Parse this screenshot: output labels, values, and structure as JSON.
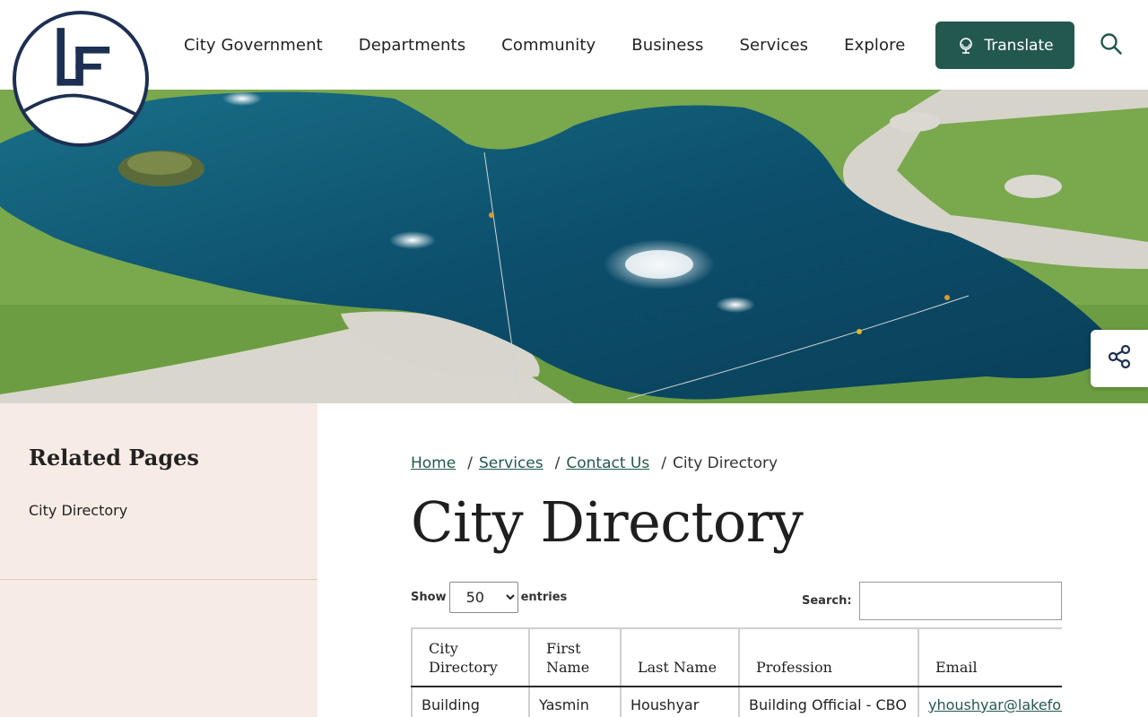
{
  "header": {
    "logo_text": "LF",
    "nav": [
      {
        "label": "City Government"
      },
      {
        "label": "Departments"
      },
      {
        "label": "Community"
      },
      {
        "label": "Business"
      },
      {
        "label": "Services"
      },
      {
        "label": "Explore"
      }
    ],
    "translate_label": "Translate",
    "search_icon": "search-icon",
    "brand_color": "#23584f",
    "logo_color": "#1d2f52"
  },
  "hero": {
    "image": "aerial view of park lake with fountains",
    "share_icon": "share-icon"
  },
  "sidebar": {
    "title": "Related Pages",
    "links": [
      {
        "label": "City Directory"
      }
    ]
  },
  "breadcrumb": {
    "items": [
      {
        "label": "Home"
      },
      {
        "label": "Services"
      },
      {
        "label": "Contact Us"
      }
    ],
    "current": "City Directory",
    "separator": "/"
  },
  "page_title": "City Directory",
  "table_controls": {
    "show_label": "Show",
    "entries_value": "50",
    "entries_label": "entries",
    "search_label": "Search:",
    "search_value": ""
  },
  "table": {
    "columns": [
      "City Directory",
      "First Name",
      "Last Name",
      "Profession",
      "Email"
    ],
    "rows": [
      {
        "city_directory": "Building",
        "first_name": "Yasmin",
        "last_name": "Houshyar",
        "profession": "Building Official - CBO",
        "email": "yhoushyar@lakeforestca.gov"
      }
    ]
  }
}
